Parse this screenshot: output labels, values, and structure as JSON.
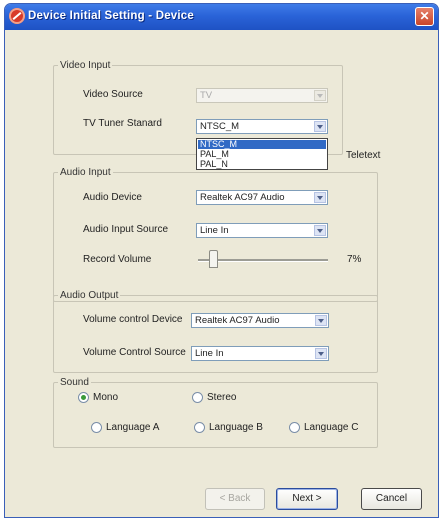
{
  "window": {
    "title": "Device Initial Setting - Device",
    "close_glyph": "✕"
  },
  "video_input": {
    "legend": "Video Input",
    "video_source": {
      "label": "Video Source",
      "value": "TV"
    },
    "tv_tuner": {
      "label": "TV Tuner Stanard",
      "value": "NTSC_M",
      "options": [
        "NTSC_M",
        "PAL_M",
        "PAL_N"
      ],
      "selected_index": 0
    },
    "teletext_label": "Teletext"
  },
  "audio_input": {
    "legend": "Audio Input",
    "audio_device": {
      "label": "Audio Device",
      "value": "Realtek AC97 Audio"
    },
    "audio_input_source": {
      "label": "Audio Input Source",
      "value": "Line In"
    },
    "record_volume": {
      "label": "Record Volume",
      "value_text": "7%",
      "value": 7
    }
  },
  "audio_output": {
    "legend": "Audio Output",
    "volume_control_device": {
      "label": "Volume control Device",
      "value": "Realtek AC97 Audio"
    },
    "volume_control_source": {
      "label": "Volume Control Source",
      "value": "Line In"
    }
  },
  "sound": {
    "legend": "Sound",
    "options": [
      {
        "label": "Mono",
        "checked": true
      },
      {
        "label": "Stereo",
        "checked": false
      },
      {
        "label": "Language A",
        "checked": false
      },
      {
        "label": "Language B",
        "checked": false
      },
      {
        "label": "Language C",
        "checked": false
      }
    ]
  },
  "buttons": {
    "back": "< Back",
    "next": "Next >",
    "cancel": "Cancel"
  },
  "icons": {
    "app": "app-logo-icon",
    "close": "close-icon",
    "dropdown": "chevron-down-icon"
  },
  "colors": {
    "titlebar": "#2a63d8",
    "dialog_bg": "#ece9d8",
    "selection": "#316ac5",
    "close_button": "#d3543a"
  }
}
